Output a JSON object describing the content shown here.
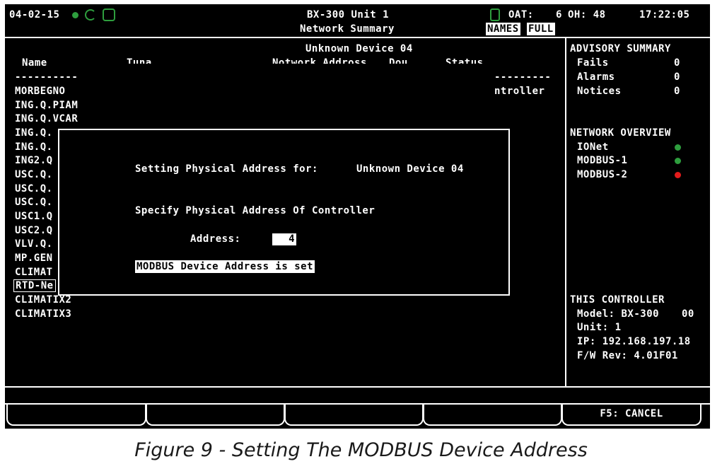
{
  "header": {
    "date": "04-02-15",
    "unit_title": "BX-300 Unit 1",
    "screen_title": "Network Summary",
    "oat": "OAT:",
    "oat_value": "6",
    "oh_label": "OH: 48",
    "time": "17:22:05",
    "names_tag": "NAMES",
    "full_tag": "FULL",
    "colors": {
      "green": "#2e9e3e",
      "red": "#e21b1b"
    }
  },
  "table": {
    "device_title": "Unknown Device 04",
    "col_name": "Name",
    "col_type": "Tuna",
    "col_network_address": "Notwork Addross",
    "col_rev": "Dou",
    "col_status": "Status",
    "name_rule": "----------",
    "status_rule": "---------",
    "status_value": "ntroller",
    "rows": [
      "MORBEGNO",
      "ING.Q.PIAM",
      "ING.Q.VCAR",
      "ING.Q.",
      "ING.Q.",
      "ING2.Q",
      "USC.Q.",
      "USC.Q.",
      "USC.Q.",
      "USC1.Q",
      "USC2.Q",
      "VLV.Q.",
      "MP.GEN",
      "CLIMAT",
      "RTD-Ne",
      "CLIMATIX2",
      "CLIMATIX3"
    ],
    "selected_row_index": 14
  },
  "dialog": {
    "setting_label": "Setting Physical Address for:",
    "device_name": "Unknown Device 04",
    "specify_label": "Specify Physical Address Of Controller",
    "address_label": "Address:",
    "address_value": "4",
    "message": "MODBUS Device Address is set"
  },
  "advisory": {
    "title": "ADVISORY SUMMARY",
    "items": [
      {
        "label": "Fails",
        "value": "0"
      },
      {
        "label": "Alarms",
        "value": "0"
      },
      {
        "label": "Notices",
        "value": "0"
      }
    ]
  },
  "network": {
    "title": "NETWORK OVERVIEW",
    "items": [
      {
        "label": "IONet",
        "status": "green"
      },
      {
        "label": "MODBUS-1",
        "status": "green"
      },
      {
        "label": "MODBUS-2",
        "status": "red"
      }
    ]
  },
  "controller": {
    "title": "THIS CONTROLLER",
    "model": "Model: BX-300",
    "model_code": "00",
    "unit": "Unit: 1",
    "ip": "IP: 192.168.197.18",
    "fw": "F/W Rev: 4.01F01"
  },
  "softkeys": {
    "f5": "F5: CANCEL"
  },
  "caption": "Figure 9 - Setting The MODBUS Device Address"
}
